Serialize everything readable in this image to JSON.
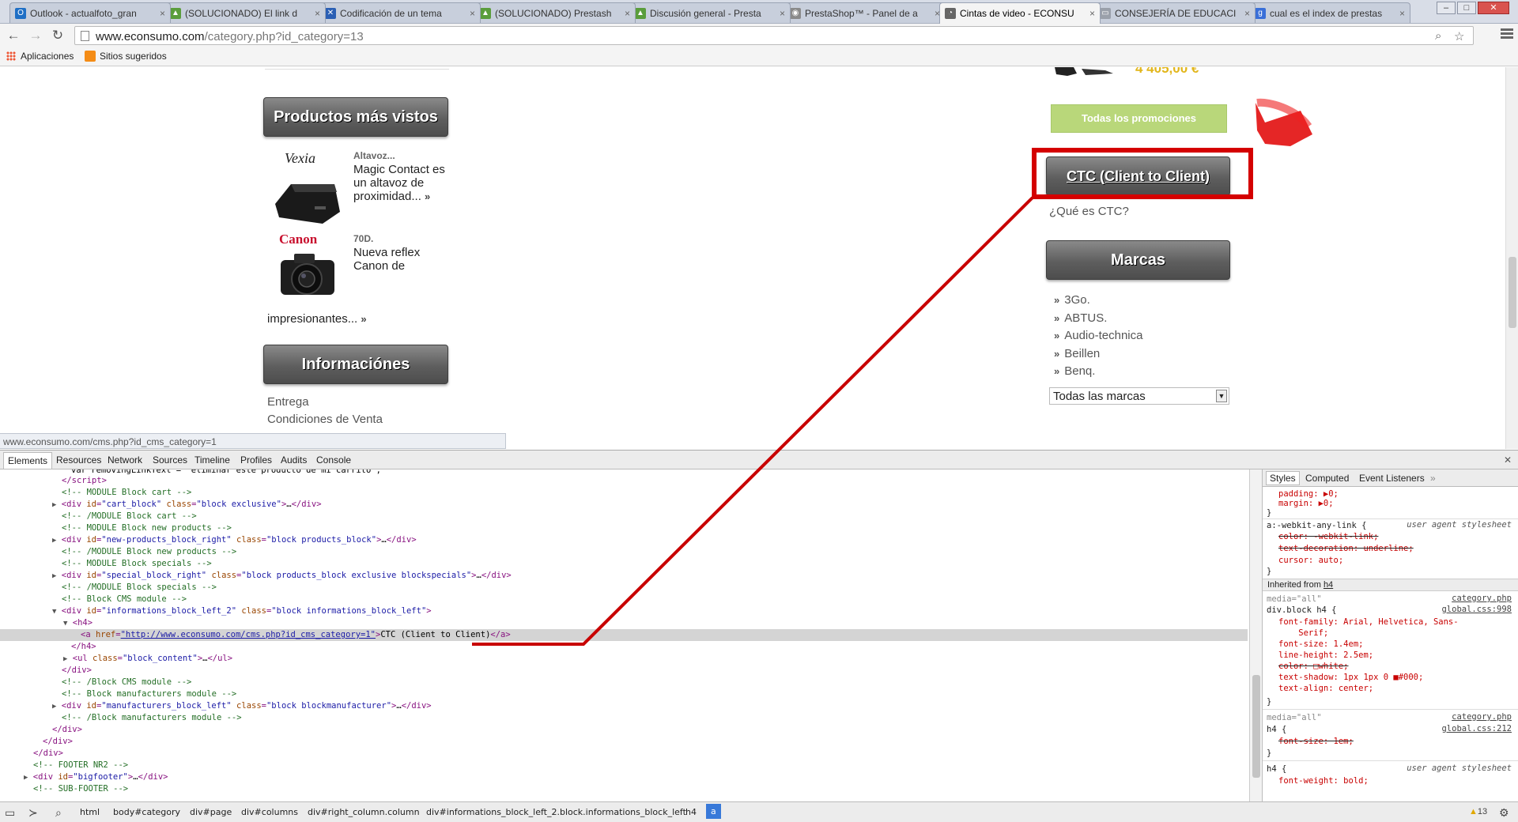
{
  "browser": {
    "tabs": [
      {
        "title": "Outlook - actualfoto_gran",
        "icon": "outlook-icon",
        "color": "#1f6fc5",
        "glyph": "O"
      },
      {
        "title": "(SOLUCIONADO) El link d",
        "icon": "forum-icon",
        "color": "#5a9d3c",
        "glyph": "▲"
      },
      {
        "title": "Codificación de un tema",
        "icon": "x-icon",
        "color": "#2b5fb4",
        "glyph": "✕"
      },
      {
        "title": "(SOLUCIONADO) Prestash",
        "icon": "forum-icon",
        "color": "#5a9d3c",
        "glyph": "▲"
      },
      {
        "title": "Discusión general - Presta",
        "icon": "forum-icon",
        "color": "#5a9d3c",
        "glyph": "▲"
      },
      {
        "title": "PrestaShop™ - Panel de a",
        "icon": "prestashop-icon",
        "color": "#8a8a8a",
        "glyph": "◉"
      },
      {
        "title": "Cintas de video - ECONSU",
        "icon": "econsumo-icon",
        "color": "#666666",
        "glyph": "◔"
      },
      {
        "title": "CONSEJERÍA DE EDUCACI",
        "icon": "page-icon",
        "color": "#9aa0aa",
        "glyph": "▭"
      },
      {
        "title": "cual es el index de prestas",
        "icon": "google-icon",
        "color": "#3a6fd8",
        "glyph": "g"
      }
    ],
    "url_host": "www.econsumo.com",
    "url_path": "/category.php?id_category=13",
    "bookmarks": [
      {
        "label": "Aplicaciones",
        "icon": "apps-grid-icon"
      },
      {
        "label": "Sitios sugeridos",
        "icon": "suggested-sites-icon"
      }
    ],
    "status_url": "www.econsumo.com/cms.php?id_cms_category=1"
  },
  "page": {
    "price": "4 405,00 €",
    "promotions_button": "Todas los promociones",
    "most_viewed_title": "Productos más vistos",
    "products": [
      {
        "brand": "Vexia",
        "name": "Altavoz...",
        "desc": [
          "Magic Contact es",
          "un altavoz de",
          "proximidad..."
        ]
      },
      {
        "brand": "Canon",
        "name": "70D.",
        "desc": [
          "Nueva reflex",
          "Canon de"
        ],
        "desc_tail": "impresionantes..."
      }
    ],
    "info_title": "Informaciónes",
    "info_links": [
      "Entrega",
      "Condiciones de Venta"
    ],
    "ctc_title": "CTC (Client to Client)",
    "ctc_link": "¿Qué es CTC?",
    "brands_title": "Marcas",
    "brands": [
      "3Go.",
      "ABTUS.",
      "Audio-technica",
      "Beillen",
      "Benq."
    ],
    "brands_select": "Todas las marcas"
  },
  "devtools": {
    "tabs": [
      "Elements",
      "Resources",
      "Network",
      "Sources",
      "Timeline",
      "Profiles",
      "Audits",
      "Console"
    ],
    "styles_tabs": [
      "Styles",
      "Computed",
      "Event Listeners"
    ],
    "breadcrumbs": [
      "html",
      "body#category",
      "div#page",
      "div#columns",
      "div#right_column.column",
      "div#informations_block_left_2.block.informations_block_left",
      "h4",
      "a"
    ],
    "warnings": "13",
    "styles": {
      "rule0": [
        "padding: ▶0;",
        "margin: ▶0;"
      ],
      "ua_selector": "a:-webkit-any-link {",
      "ua_label": "user agent stylesheet",
      "ua_props": [
        "color: -webkit-link;",
        "text-decoration: underline;",
        "cursor: auto;"
      ],
      "inherited_label": "Inherited from",
      "inherited_tag": "h4",
      "media": "media=\"all\"",
      "file_page": "category.php",
      "file_css1": "global.css:998",
      "file_css2": "global.css:212",
      "rule1_selector": "div.block h4 {",
      "rule1_props": [
        "font-family: Arial, Helvetica, Sans-",
        "    Serif;",
        "font-size: 1.4em;",
        "line-height: 2.5em;",
        "color: □white;",
        "text-shadow: 1px 1px 0 ■#000;",
        "text-align: center;"
      ],
      "rule2_selector": "h4 {",
      "rule2_props": [
        "font-size: 1em;"
      ],
      "rule3_selector": "h4 {",
      "rule3_props": [
        "font-weight: bold;"
      ]
    }
  }
}
